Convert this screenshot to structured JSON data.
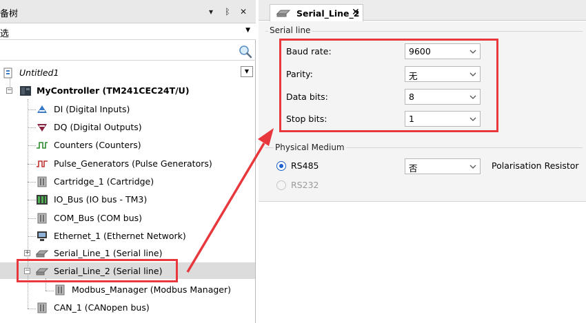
{
  "left_panel": {
    "title": "备树",
    "title_buttons": {
      "dropdown": "▾",
      "pin": "ᛒ",
      "close": "✕"
    },
    "dropdown_value": "选",
    "search": {
      "icon": "search-icon"
    },
    "tree": {
      "root": "Untitled1",
      "controller": "MyController (TM241CEC24T/U)",
      "items": [
        {
          "label": "DI (Digital Inputs)",
          "icon": "digital-inputs-icon"
        },
        {
          "label": "DQ (Digital Outputs)",
          "icon": "digital-outputs-icon"
        },
        {
          "label": "Counters (Counters)",
          "icon": "counters-icon"
        },
        {
          "label": "Pulse_Generators (Pulse Generators)",
          "icon": "pulse-generators-icon"
        },
        {
          "label": "Cartridge_1 (Cartridge)",
          "icon": "cartridge-icon"
        },
        {
          "label": "IO_Bus (IO bus - TM3)",
          "icon": "io-bus-icon"
        },
        {
          "label": "COM_Bus (COM bus)",
          "icon": "com-bus-icon"
        },
        {
          "label": "Ethernet_1 (Ethernet Network)",
          "icon": "ethernet-icon"
        },
        {
          "label": "Serial_Line_1 (Serial line)",
          "icon": "serial-line-icon"
        },
        {
          "label": "Serial_Line_2 (Serial line)",
          "icon": "serial-line-icon"
        },
        {
          "label": "Modbus_Manager (Modbus Manager)",
          "icon": "modbus-manager-icon"
        },
        {
          "label": "CAN_1 (CANopen bus)",
          "icon": "canopen-bus-icon"
        }
      ]
    }
  },
  "editor": {
    "tab_label": "Serial_Line_2",
    "tab_close": "✕",
    "serial_line": {
      "group_title": "Serial line",
      "fields": [
        {
          "label": "Baud rate:",
          "value": "9600"
        },
        {
          "label": "Parity:",
          "value": "无"
        },
        {
          "label": "Data bits:",
          "value": "8"
        },
        {
          "label": "Stop bits:",
          "value": "1"
        }
      ]
    },
    "physical_medium": {
      "group_title": "Physical Medium",
      "rs485": {
        "label": "RS485",
        "selected": true
      },
      "rs232": {
        "label": "RS232",
        "selected": false,
        "enabled": false
      },
      "polarisation_value": "否",
      "polarisation_label": "Polarisation Resistor"
    }
  },
  "colors": {
    "annotation_red": "#e8383d",
    "radio_blue": "#1c5fd1",
    "panel_gray": "#f4f4f4"
  }
}
